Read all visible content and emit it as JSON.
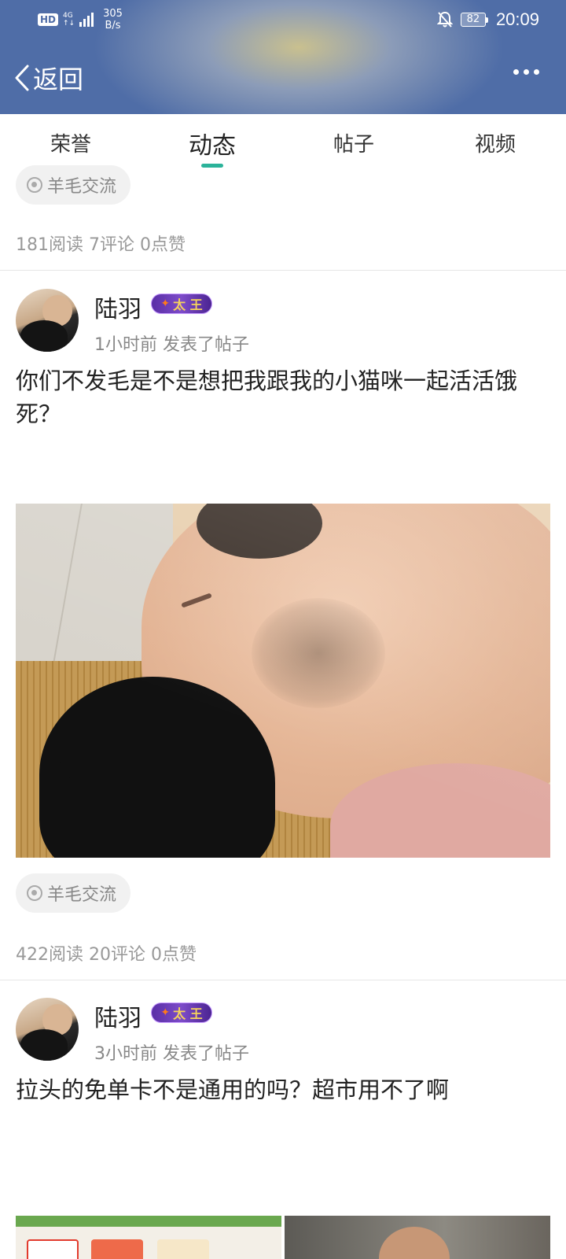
{
  "status_bar": {
    "hd": "HD",
    "net_top": "4G",
    "net_bottom": "↑↓",
    "speed_value": "305",
    "speed_unit": "B/s",
    "battery": "82",
    "time": "20:09",
    "icons": [
      "signal-icon",
      "mute-bell-icon",
      "battery-icon"
    ]
  },
  "nav": {
    "back_label": "返回",
    "more_icon": "more-dots-icon"
  },
  "tabs": [
    {
      "label": "荣誉",
      "active": false
    },
    {
      "label": "动态",
      "active": true
    },
    {
      "label": "帖子",
      "active": false
    },
    {
      "label": "视频",
      "active": false
    }
  ],
  "accent_color": "#2bb39a",
  "feed": {
    "first_tag": "羊毛交流",
    "first_stats": "181阅读 7评论 0点赞",
    "posts": [
      {
        "username": "陆羽",
        "badge": "太 王",
        "meta": "1小时前  发表了帖子",
        "text": "你们不发毛是不是想把我跟我的小猫咪一起活活饿死？",
        "tag": "羊毛交流",
        "stats": "422阅读 20评论 0点赞"
      },
      {
        "username": "陆羽",
        "badge": "太 王",
        "meta": "3小时前  发表了帖子",
        "text": "拉头的免单卡不是通用的吗？超市用不了啊"
      }
    ]
  }
}
